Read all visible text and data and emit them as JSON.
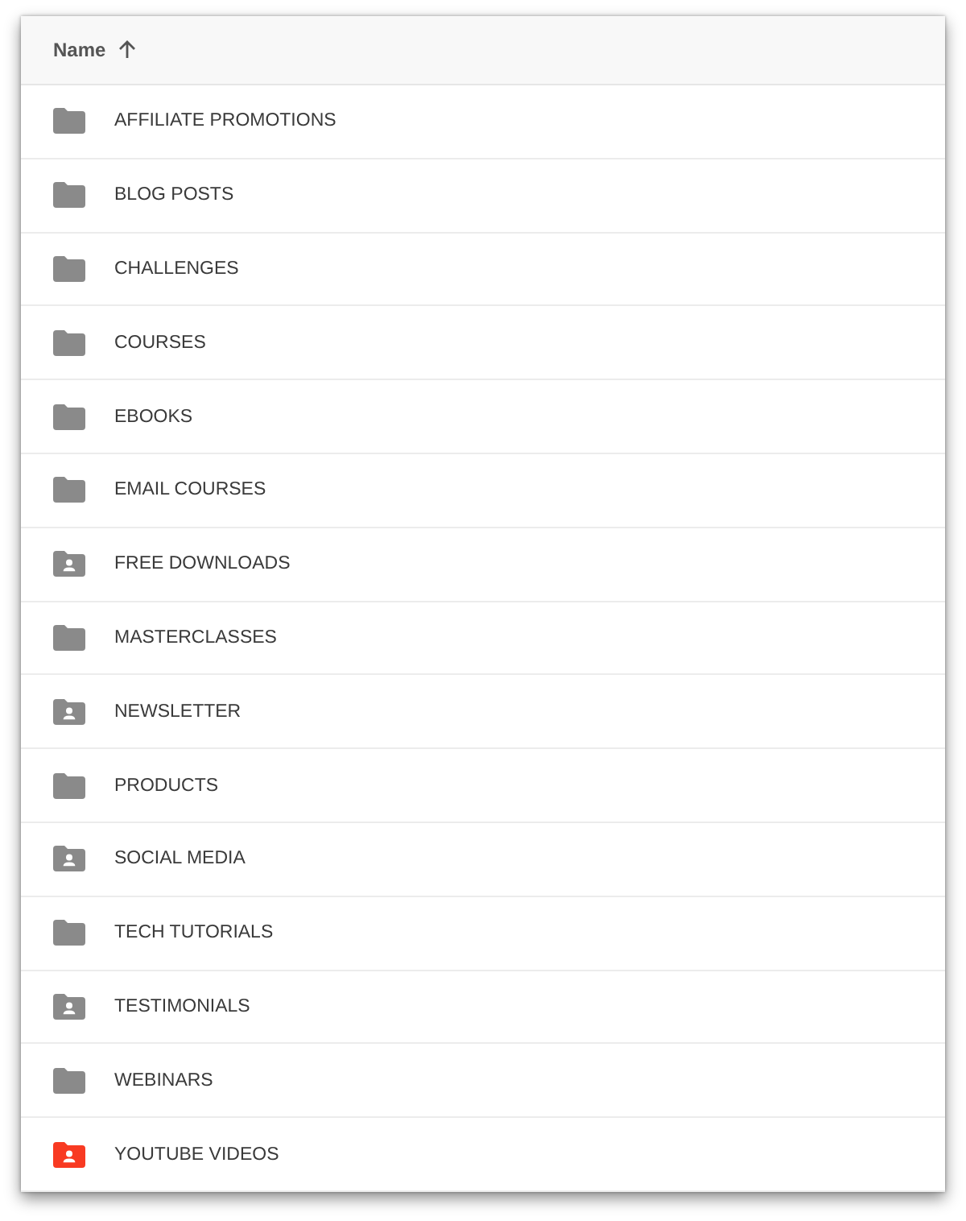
{
  "file_list": {
    "header": {
      "label": "Name",
      "sort_ascending": true
    },
    "rows": [
      {
        "name": "AFFILIATE PROMOTIONS",
        "kind": "folder",
        "color": "#8a8a8a"
      },
      {
        "name": "BLOG POSTS",
        "kind": "folder",
        "color": "#8a8a8a"
      },
      {
        "name": "CHALLENGES",
        "kind": "folder",
        "color": "#8a8a8a"
      },
      {
        "name": "COURSES",
        "kind": "folder",
        "color": "#8a8a8a"
      },
      {
        "name": "EBOOKS",
        "kind": "folder",
        "color": "#8a8a8a"
      },
      {
        "name": "EMAIL COURSES",
        "kind": "folder",
        "color": "#8a8a8a"
      },
      {
        "name": "FREE DOWNLOADS",
        "kind": "shared",
        "color": "#8a8a8a"
      },
      {
        "name": "MASTERCLASSES",
        "kind": "folder",
        "color": "#8a8a8a"
      },
      {
        "name": "NEWSLETTER",
        "kind": "shared",
        "color": "#8a8a8a"
      },
      {
        "name": "PRODUCTS",
        "kind": "folder",
        "color": "#8a8a8a"
      },
      {
        "name": "SOCIAL MEDIA",
        "kind": "shared",
        "color": "#8a8a8a"
      },
      {
        "name": "TECH TUTORIALS",
        "kind": "folder",
        "color": "#8a8a8a"
      },
      {
        "name": "TESTIMONIALS",
        "kind": "shared",
        "color": "#8a8a8a"
      },
      {
        "name": "WEBINARS",
        "kind": "folder",
        "color": "#8a8a8a"
      },
      {
        "name": "YOUTUBE VIDEOS",
        "kind": "shared",
        "color": "#f83a22"
      }
    ]
  }
}
